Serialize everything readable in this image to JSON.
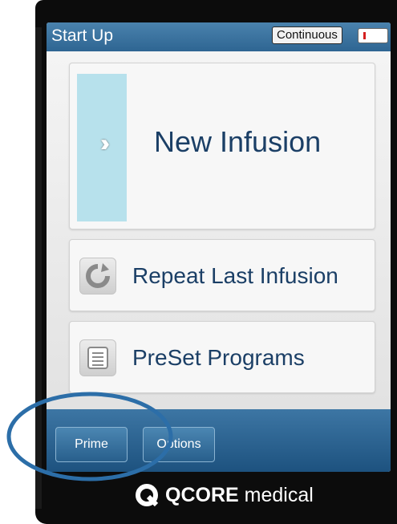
{
  "header": {
    "title": "Start Up",
    "mode": "Continuous",
    "battery_icon": "battery-icon"
  },
  "menu": {
    "new_infusion": {
      "label": "New Infusion",
      "icon": "double-chevron-right-icon"
    },
    "repeat_last": {
      "label": "Repeat Last Infusion",
      "icon": "refresh-icon"
    },
    "preset_programs": {
      "label": "PreSet Programs",
      "icon": "list-icon"
    }
  },
  "footer": {
    "prime_label": "Prime",
    "options_label": "Options"
  },
  "brand": {
    "name_bold": "QCORE",
    "name_rest": " medical",
    "logo_icon": "qcore-logo-icon"
  },
  "colors": {
    "header_blue": "#2e6592",
    "accent_light_blue": "#b7e1ec",
    "text_navy": "#1b3f66",
    "battery_red": "#d42020",
    "annotation_ring": "#2c6ea8"
  }
}
